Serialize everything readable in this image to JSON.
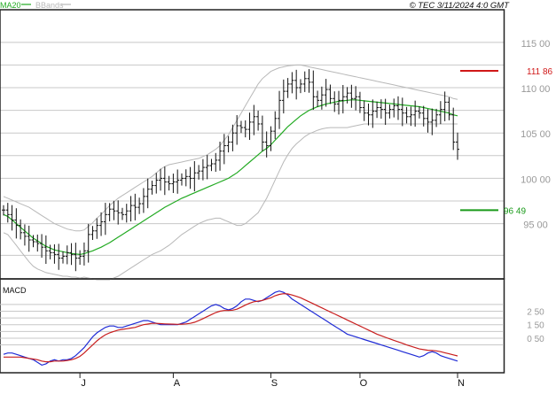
{
  "header": {
    "legend_ma": "MA20",
    "legend_bb": "BBands",
    "copyright": "© TEC 3/11/2024 4:0 GMT"
  },
  "colors": {
    "ma": "#22aa22",
    "bb": "#b8b8b8",
    "candles": "#111111",
    "macd": "#1f2bd6",
    "signal": "#c81e1e",
    "resistance": "#d01818",
    "support": "#1a9a1a",
    "grid": "#c8c8c8",
    "panel_border": "#222222"
  },
  "chart_data": [
    {
      "type": "candlestick",
      "title": "",
      "ylim": [
        8900,
        11850
      ],
      "yticks": [
        9500,
        10000,
        10500,
        11000,
        11500
      ],
      "ytick_labels": [
        "95 00",
        "100 00",
        "105 00",
        "110 00",
        "115 00"
      ],
      "grid": true,
      "x_month_labels": [
        {
          "label": "J",
          "index": 18
        },
        {
          "label": "A",
          "index": 40
        },
        {
          "label": "S",
          "index": 63
        },
        {
          "label": "O",
          "index": 84
        },
        {
          "label": "N",
          "index": 107
        }
      ],
      "close": [
        9650,
        9600,
        9540,
        9480,
        9400,
        9360,
        9320,
        9300,
        9280,
        9240,
        9200,
        9180,
        9160,
        9120,
        9140,
        9180,
        9160,
        9120,
        9140,
        9200,
        9380,
        9420,
        9480,
        9520,
        9600,
        9660,
        9640,
        9620,
        9600,
        9640,
        9700,
        9680,
        9720,
        9800,
        9880,
        9920,
        9980,
        10000,
        9960,
        9940,
        9960,
        9980,
        10000,
        10020,
        10000,
        10060,
        10080,
        10120,
        10140,
        10160,
        10200,
        10300,
        10360,
        10400,
        10500,
        10580,
        10560,
        10540,
        10620,
        10680,
        10600,
        10400,
        10360,
        10520,
        10660,
        10860,
        10960,
        11040,
        11080,
        11000,
        11040,
        11100,
        11060,
        10900,
        10860,
        10920,
        10980,
        10880,
        10820,
        10860,
        10900,
        10940,
        10880,
        10900,
        10780,
        10720,
        10700,
        10740,
        10780,
        10760,
        10720,
        10760,
        10800,
        10760,
        10720,
        10680,
        10700,
        10740,
        10720,
        10660,
        10620,
        10640,
        10700,
        10760,
        10840,
        10700,
        10400,
        10320
      ],
      "ma20": [
        9600,
        9580,
        9540,
        9500,
        9460,
        9420,
        9380,
        9340,
        9310,
        9280,
        9250,
        9230,
        9210,
        9200,
        9190,
        9180,
        9170,
        9165,
        9160,
        9170,
        9185,
        9200,
        9220,
        9240,
        9265,
        9290,
        9320,
        9350,
        9380,
        9410,
        9440,
        9470,
        9500,
        9530,
        9560,
        9590,
        9620,
        9650,
        9680,
        9705,
        9730,
        9755,
        9780,
        9800,
        9820,
        9840,
        9860,
        9880,
        9900,
        9920,
        9940,
        9960,
        9980,
        10000,
        10030,
        10060,
        10100,
        10140,
        10180,
        10220,
        10260,
        10300,
        10330,
        10370,
        10420,
        10470,
        10520,
        10570,
        10610,
        10650,
        10690,
        10720,
        10750,
        10770,
        10790,
        10805,
        10820,
        10830,
        10840,
        10850,
        10855,
        10860,
        10865,
        10865,
        10860,
        10855,
        10850,
        10845,
        10840,
        10835,
        10830,
        10825,
        10820,
        10815,
        10810,
        10805,
        10800,
        10795,
        10790,
        10780,
        10770,
        10760,
        10750,
        10740,
        10730,
        10720,
        10700,
        10690
      ],
      "bb_upper": [
        9800,
        9780,
        9760,
        9740,
        9720,
        9700,
        9680,
        9650,
        9620,
        9590,
        9560,
        9530,
        9500,
        9480,
        9460,
        9440,
        9430,
        9420,
        9420,
        9430,
        9470,
        9510,
        9560,
        9600,
        9650,
        9700,
        9740,
        9780,
        9810,
        9840,
        9870,
        9900,
        9930,
        9960,
        9990,
        10020,
        10060,
        10100,
        10130,
        10150,
        10160,
        10170,
        10180,
        10190,
        10200,
        10210,
        10220,
        10240,
        10260,
        10290,
        10320,
        10360,
        10420,
        10480,
        10560,
        10640,
        10720,
        10800,
        10880,
        10960,
        11040,
        11100,
        11140,
        11180,
        11200,
        11220,
        11230,
        11240,
        11245,
        11250,
        11250,
        11240,
        11230,
        11220,
        11210,
        11200,
        11190,
        11180,
        11170,
        11160,
        11150,
        11140,
        11130,
        11120,
        11110,
        11100,
        11090,
        11080,
        11070,
        11060,
        11050,
        11040,
        11030,
        11020,
        11010,
        11000,
        10990,
        10980,
        10970,
        10960,
        10950,
        10940,
        10930,
        10920,
        10910,
        10900,
        10880,
        10870
      ],
      "bb_lower": [
        9400,
        9380,
        9320,
        9260,
        9200,
        9140,
        9080,
        9030,
        9000,
        8980,
        8960,
        8950,
        8940,
        8930,
        8920,
        8920,
        8910,
        8910,
        8900,
        8910,
        8900,
        8890,
        8880,
        8880,
        8880,
        8880,
        8900,
        8920,
        8950,
        8980,
        9010,
        9040,
        9070,
        9100,
        9130,
        9160,
        9180,
        9200,
        9230,
        9260,
        9300,
        9340,
        9380,
        9410,
        9440,
        9470,
        9500,
        9520,
        9540,
        9550,
        9560,
        9560,
        9540,
        9520,
        9500,
        9480,
        9480,
        9500,
        9540,
        9580,
        9620,
        9700,
        9780,
        9880,
        9980,
        10080,
        10180,
        10260,
        10330,
        10380,
        10420,
        10460,
        10490,
        10510,
        10530,
        10545,
        10555,
        10560,
        10560,
        10560,
        10560,
        10560,
        10570,
        10580,
        10590,
        10600,
        10600,
        10600,
        10600,
        10600,
        10600,
        10600,
        10600,
        10600,
        10600,
        10600,
        10600,
        10600,
        10600,
        10600,
        10600,
        10600,
        10600,
        10600,
        10600,
        10600,
        10600,
        10600
      ],
      "annotations": [
        {
          "label": "111 86",
          "value": 11186,
          "color": "resistance"
        },
        {
          "label": "96 49",
          "value": 9649,
          "color": "support"
        }
      ]
    },
    {
      "type": "line",
      "title": "MACD",
      "ylim": [
        -200,
        470
      ],
      "yticks": [
        50,
        150,
        250
      ],
      "ytick_labels": [
        "0 50",
        "1 50",
        "2 50"
      ],
      "series": [
        {
          "name": "",
          "role": "macd",
          "values": [
            -70,
            -60,
            -60,
            -70,
            -80,
            -90,
            -100,
            -110,
            -130,
            -150,
            -140,
            -120,
            -110,
            -120,
            -110,
            -110,
            -100,
            -80,
            -50,
            -20,
            20,
            60,
            90,
            110,
            130,
            140,
            140,
            130,
            130,
            140,
            150,
            160,
            170,
            180,
            180,
            170,
            160,
            150,
            150,
            150,
            150,
            150,
            160,
            170,
            190,
            210,
            230,
            250,
            270,
            290,
            300,
            290,
            270,
            260,
            270,
            290,
            320,
            340,
            340,
            330,
            320,
            330,
            350,
            370,
            390,
            400,
            390,
            370,
            340,
            320,
            300,
            280,
            260,
            240,
            220,
            200,
            180,
            160,
            140,
            120,
            100,
            80,
            70,
            60,
            50,
            40,
            30,
            20,
            10,
            0,
            -10,
            -20,
            -30,
            -40,
            -50,
            -60,
            -70,
            -80,
            -90,
            -80,
            -60,
            -50,
            -60,
            -80,
            -90,
            -100,
            -110,
            -120
          ]
        },
        {
          "name": "",
          "role": "signal",
          "values": [
            -90,
            -90,
            -90,
            -90,
            -90,
            -95,
            -100,
            -105,
            -110,
            -120,
            -125,
            -125,
            -120,
            -120,
            -120,
            -115,
            -110,
            -100,
            -85,
            -60,
            -30,
            0,
            30,
            55,
            75,
            90,
            100,
            110,
            115,
            120,
            125,
            130,
            140,
            150,
            155,
            160,
            160,
            158,
            156,
            155,
            154,
            153,
            154,
            156,
            160,
            168,
            180,
            195,
            210,
            225,
            240,
            250,
            255,
            255,
            258,
            265,
            280,
            295,
            310,
            320,
            325,
            330,
            340,
            350,
            365,
            375,
            380,
            378,
            370,
            360,
            350,
            335,
            320,
            305,
            290,
            275,
            260,
            245,
            230,
            215,
            200,
            185,
            170,
            155,
            140,
            125,
            110,
            95,
            80,
            68,
            56,
            45,
            34,
            23,
            12,
            0,
            -10,
            -20,
            -30,
            -35,
            -40,
            -42,
            -44,
            -50,
            -58,
            -66,
            -74,
            -82
          ]
        }
      ]
    }
  ]
}
